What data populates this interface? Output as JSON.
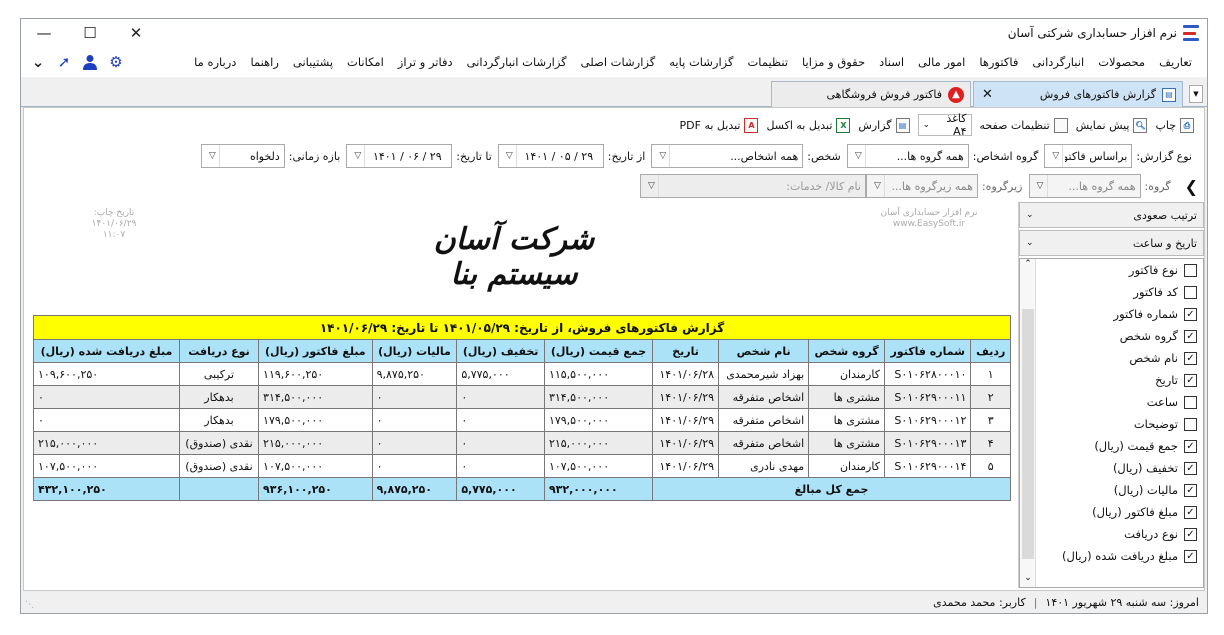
{
  "window": {
    "title": "نرم افزار حسابداری شرکتی آسان",
    "min": "—",
    "max": "☐",
    "close": "✕"
  },
  "menu": [
    "تعاریف",
    "محصولات",
    "انبارگردانی",
    "فاکتورها",
    "امور مالی",
    "اسناد",
    "حقوق و مزایا",
    "تنظیمات",
    "گزارشات پایه",
    "گزارشات اصلی",
    "گزارشات انبارگردانی",
    "دفاتر و تراز",
    "امکانات",
    "پشتیبانی",
    "راهنما",
    "درباره ما"
  ],
  "tabs": [
    {
      "label": "گزارش فاکتورهای فروش",
      "active": true
    },
    {
      "label": "فاکتور فروش فروشگاهی",
      "active": false
    }
  ],
  "toolbar": {
    "print": "چاپ",
    "preview": "پیش نمایش",
    "page_settings": "تنظیمات صفحه",
    "paper": "کاغذ A۴",
    "report": "گزارش",
    "excel": "تبدیل به اکسل",
    "pdf": "تبدیل به PDF"
  },
  "filters": {
    "report_type_label": "نوع گزارش:",
    "report_type_value": "براساس فاکتور",
    "person_group_label": "گروه اشخاص:",
    "person_group_value": "همه گروه ها...",
    "person_label": "شخص:",
    "person_value": "همه اشخاص...",
    "from_date_label": "از تاریخ:",
    "from_date_value": "۱۴۰۱ / ۰۵ / ۲۹",
    "to_date_label": "تا تاریخ:",
    "to_date_value": "۱۴۰۱ / ۰۶ / ۲۹",
    "period_label": "بازه زمانی:",
    "period_value": "دلخواه",
    "group_label": "گروه:",
    "group_value": "همه گروه ها...",
    "subgroup_label": "زیرگروه:",
    "subgroup_value": "همه زیرگروه ها...",
    "goods_value": "نام کالا/ خدمات:"
  },
  "right_panel": {
    "sort": "ترتیب صعودی",
    "sort_by": "تاریخ و ساعت",
    "columns": [
      {
        "label": "نوع فاکتور",
        "checked": false
      },
      {
        "label": "کد فاکتور",
        "checked": false
      },
      {
        "label": "شماره فاکتور",
        "checked": true
      },
      {
        "label": "گروه شخص",
        "checked": true
      },
      {
        "label": "نام شخص",
        "checked": true
      },
      {
        "label": "تاریخ",
        "checked": true
      },
      {
        "label": "ساعت",
        "checked": false
      },
      {
        "label": "توضیحات",
        "checked": false
      },
      {
        "label": "جمع قیمت (ریال)",
        "checked": true
      },
      {
        "label": "تخفیف (ریال)",
        "checked": true
      },
      {
        "label": "مالیات (ریال)",
        "checked": true
      },
      {
        "label": "مبلغ فاکتور (ریال)",
        "checked": true
      },
      {
        "label": "نوع دریافت",
        "checked": true
      },
      {
        "label": "مبلغ دریافت شده (ریال)",
        "checked": true
      }
    ]
  },
  "report": {
    "print_date_label": "تاریخ چاپ:",
    "print_date": "۱۴۰۱/۰۶/۲۹",
    "print_time": "۱۱:۰۷",
    "software_name": "نرم افزار حسابداری آسان",
    "website": "www.EasySoft.ir",
    "company": "شرکت آسان سیستم بنا",
    "title": "گزارش فاکتورهای فروش، از تاریخ: ۱۴۰۱/۰۵/۲۹ تا تاریخ: ۱۴۰۱/۰۶/۲۹",
    "headers": [
      "ردیف",
      "شماره فاکتور",
      "گروه شخص",
      "نام شخص",
      "تاریخ",
      "جمع قیمت (ریال)",
      "تخفیف (ریال)",
      "مالیات (ریال)",
      "مبلغ فاکتور (ریال)",
      "نوع دریافت",
      "مبلغ دریافت شده (ریال)"
    ],
    "rows": [
      [
        "۱",
        "S۰۱۰۶۲۸۰۰۰۱۰",
        "کارمندان",
        "بهزاد شیرمحمدی",
        "۱۴۰۱/۰۶/۲۸",
        "۱۱۵,۵۰۰,۰۰۰",
        "۵,۷۷۵,۰۰۰",
        "۹,۸۷۵,۲۵۰",
        "۱۱۹,۶۰۰,۲۵۰",
        "ترکیبی",
        "۱۰۹,۶۰۰,۲۵۰"
      ],
      [
        "۲",
        "S۰۱۰۶۲۹۰۰۰۱۱",
        "مشتری ها",
        "اشخاص متفرقه",
        "۱۴۰۱/۰۶/۲۹",
        "۳۱۴,۵۰۰,۰۰۰",
        "۰",
        "۰",
        "۳۱۴,۵۰۰,۰۰۰",
        "بدهکار",
        "۰"
      ],
      [
        "۳",
        "S۰۱۰۶۲۹۰۰۰۱۲",
        "مشتری ها",
        "اشخاص متفرقه",
        "۱۴۰۱/۰۶/۲۹",
        "۱۷۹,۵۰۰,۰۰۰",
        "۰",
        "۰",
        "۱۷۹,۵۰۰,۰۰۰",
        "بدهکار",
        "۰"
      ],
      [
        "۴",
        "S۰۱۰۶۲۹۰۰۰۱۳",
        "مشتری ها",
        "اشخاص متفرقه",
        "۱۴۰۱/۰۶/۲۹",
        "۲۱۵,۰۰۰,۰۰۰",
        "۰",
        "۰",
        "۲۱۵,۰۰۰,۰۰۰",
        "نقدی (صندوق)",
        "۲۱۵,۰۰۰,۰۰۰"
      ],
      [
        "۵",
        "S۰۱۰۶۲۹۰۰۰۱۴",
        "کارمندان",
        "مهدی نادری",
        "۱۴۰۱/۰۶/۲۹",
        "۱۰۷,۵۰۰,۰۰۰",
        "۰",
        "۰",
        "۱۰۷,۵۰۰,۰۰۰",
        "نقدی (صندوق)",
        "۱۰۷,۵۰۰,۰۰۰"
      ]
    ],
    "total_label": "جمع کل مبالغ",
    "totals": {
      "sum_price": "۹۳۲,۰۰۰,۰۰۰",
      "discount": "۵,۷۷۵,۰۰۰",
      "tax": "۹,۸۷۵,۲۵۰",
      "invoice": "۹۳۶,۱۰۰,۲۵۰",
      "payment_type": "",
      "received": "۴۳۲,۱۰۰,۲۵۰"
    }
  },
  "status": {
    "today": "امروز: سه شنبه ۲۹ شهریور ۱۴۰۱",
    "user": "کاربر: محمد محمدی"
  }
}
